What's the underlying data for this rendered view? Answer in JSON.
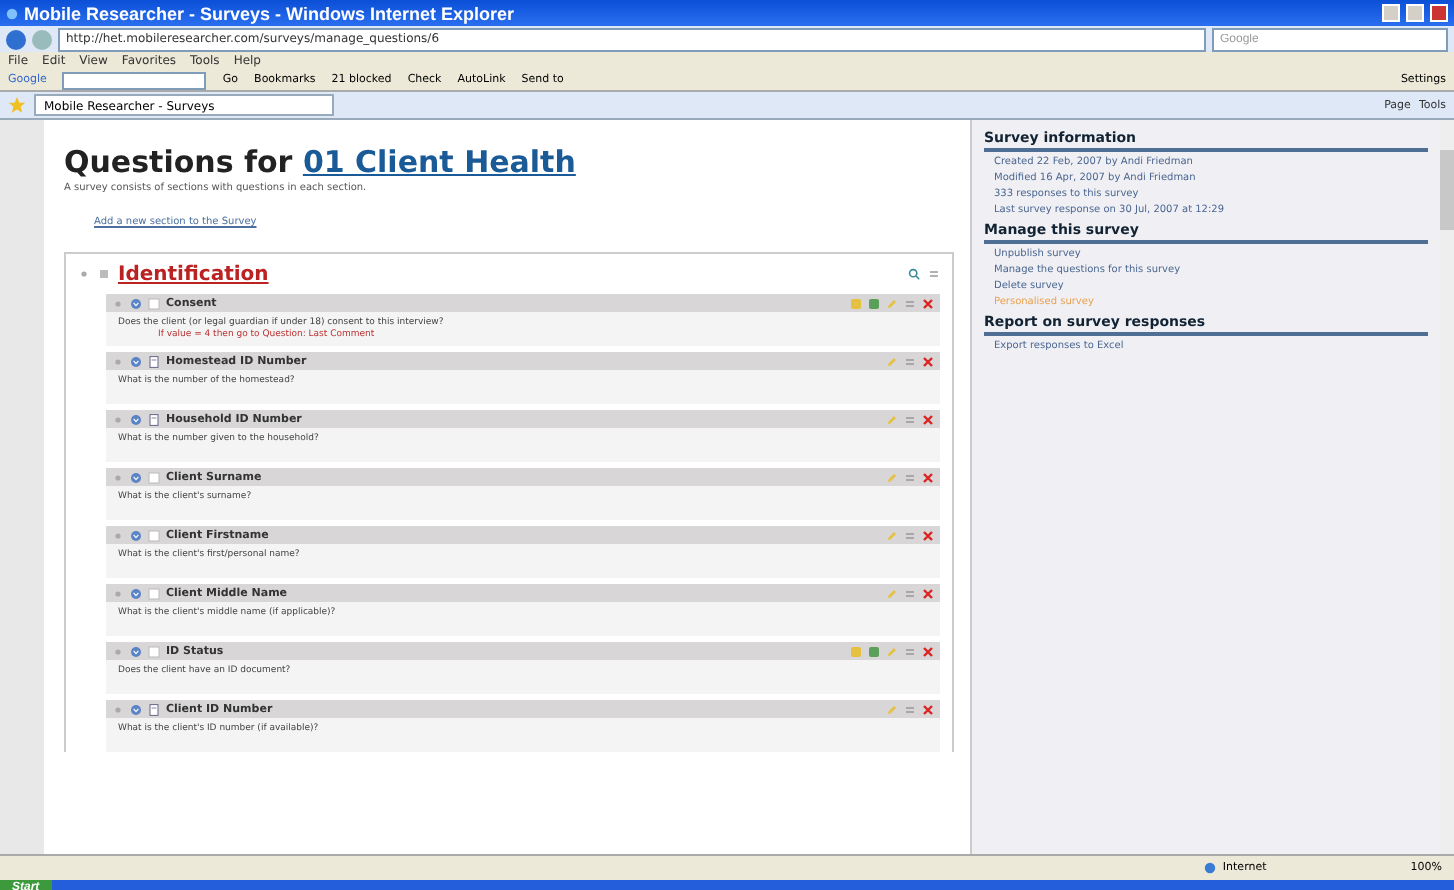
{
  "window": {
    "title": "Mobile Researcher - Surveys - Windows Internet Explorer"
  },
  "address_bar": {
    "url": "http://het.mobileresearcher.com/surveys/manage_questions/6",
    "search_placeholder": "Google"
  },
  "menu": [
    "File",
    "Edit",
    "View",
    "Favorites",
    "Tools",
    "Help"
  ],
  "google_toolbar": {
    "label": "Google",
    "go": "Go",
    "items": [
      "Bookmarks",
      "21 blocked",
      "Check",
      "AutoLink",
      "Send to"
    ],
    "settings": "Settings"
  },
  "tab": {
    "title": "Mobile Researcher - Surveys"
  },
  "command_bar": [
    "Page",
    "Tools"
  ],
  "page": {
    "heading": "Questions for ",
    "survey_name": "01 Client Health",
    "intro": "A survey consists of sections with questions in each section.",
    "add_link": "Add a new section to the Survey",
    "section": {
      "title": "Identification",
      "questions": [
        {
          "title": "Consent",
          "kind": "choice",
          "branching": true,
          "text": "Does the client (or legal guardian if under 18) consent to this interview?",
          "condition": "If value = 4 then go to Question: Last Comment"
        },
        {
          "title": "Homestead ID Number",
          "kind": "text",
          "branching": false,
          "text": "What is the number of the homestead?"
        },
        {
          "title": "Household ID Number",
          "kind": "text",
          "branching": false,
          "text": "What is the number given to the household?"
        },
        {
          "title": "Client Surname",
          "kind": "choice",
          "branching": false,
          "text": "What is the client's surname?"
        },
        {
          "title": "Client Firstname",
          "kind": "choice",
          "branching": false,
          "text": "What is the client's first/personal name?"
        },
        {
          "title": "Client Middle Name",
          "kind": "choice",
          "branching": false,
          "text": "What is the client's middle name (if applicable)?"
        },
        {
          "title": "ID Status",
          "kind": "choice",
          "branching": true,
          "text": "Does the client have an ID document?"
        },
        {
          "title": "Client ID Number",
          "kind": "text",
          "branching": false,
          "text": "What is the client's ID number (if available)?"
        }
      ]
    }
  },
  "sidebar": [
    {
      "heading": "Survey information",
      "items": [
        {
          "text": "Created 22 Feb, 2007 by Andi Friedman",
          "kind": "info"
        },
        {
          "text": "Modified 16 Apr, 2007 by Andi Friedman",
          "kind": "info"
        },
        {
          "text": "333 responses to this survey",
          "kind": "info"
        },
        {
          "text": "Last survey response on 30 Jul, 2007 at 12:29",
          "kind": "info"
        }
      ]
    },
    {
      "heading": "Manage this survey",
      "items": [
        {
          "text": "Unpublish survey",
          "kind": "link"
        },
        {
          "text": "Manage the questions for this survey",
          "kind": "link"
        },
        {
          "text": "Delete survey",
          "kind": "link"
        },
        {
          "text": "Personalised survey",
          "kind": "highlight"
        }
      ]
    },
    {
      "heading": "Report on survey responses",
      "items": [
        {
          "text": "Export responses to Excel",
          "kind": "link"
        }
      ]
    }
  ],
  "status_bar": {
    "zone": "Internet",
    "zoom": "100%"
  },
  "taskbar": {
    "start": "Start"
  }
}
